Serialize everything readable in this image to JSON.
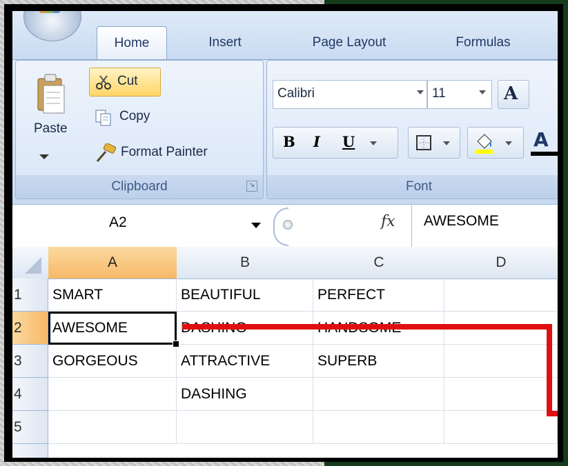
{
  "tabs": [
    {
      "label": "Home",
      "active": true
    },
    {
      "label": "Insert",
      "active": false
    },
    {
      "label": "Page Layout",
      "active": false
    },
    {
      "label": "Formulas",
      "active": false
    }
  ],
  "clipboard": {
    "paste_label": "Paste",
    "cut_label": "Cut",
    "copy_label": "Copy",
    "format_painter_label": "Format Painter",
    "group_label": "Clipboard"
  },
  "font": {
    "name": "Calibri",
    "size": "11",
    "group_label": "Font",
    "bold": "B",
    "italic": "I",
    "underline": "U",
    "grow": "A",
    "color_glyph": "A"
  },
  "formula_bar": {
    "name_box": "A2",
    "fx": "fx",
    "value": "AWESOME"
  },
  "columns": [
    "A",
    "B",
    "C",
    "D"
  ],
  "rows": [
    "1",
    "2",
    "3",
    "4",
    "5"
  ],
  "cells": [
    [
      "SMART",
      "BEAUTIFUL",
      "PERFECT",
      ""
    ],
    [
      "AWESOME",
      "DASHING",
      "HANDSOME",
      ""
    ],
    [
      "GORGEOUS",
      "ATTRACTIVE",
      "SUPERB",
      ""
    ],
    [
      "",
      "DASHING",
      "",
      ""
    ],
    [
      "",
      "",
      "",
      ""
    ]
  ],
  "colors": {
    "accent_red": "#e01010",
    "selection_orange": "#f6b868",
    "ribbon_blue": "#d4e3f6"
  }
}
